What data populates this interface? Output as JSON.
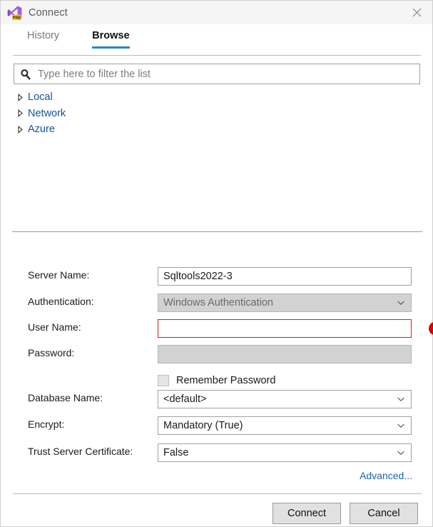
{
  "window": {
    "title": "Connect",
    "app_icon": "visual-studio-preview-icon",
    "close_icon": "close-icon"
  },
  "tabs": [
    {
      "label": "History",
      "active": false
    },
    {
      "label": "Browse",
      "active": true
    }
  ],
  "filter": {
    "icon": "search-icon",
    "placeholder": "Type here to filter the list",
    "value": ""
  },
  "tree": {
    "items": [
      {
        "label": "Local",
        "expanded": false,
        "icon": "chevron-right-icon"
      },
      {
        "label": "Network",
        "expanded": false,
        "icon": "chevron-right-icon"
      },
      {
        "label": "Azure",
        "expanded": false,
        "icon": "chevron-right-icon"
      }
    ]
  },
  "form": {
    "server_name": {
      "label": "Server Name:",
      "value": "Sqltools2022-3"
    },
    "authentication": {
      "label": "Authentication:",
      "value": "Windows Authentication"
    },
    "user_name": {
      "label": "User Name:",
      "value": "",
      "error_icon": "error-exclamation-icon"
    },
    "password": {
      "label": "Password:",
      "value": ""
    },
    "remember_password": {
      "label": "Remember Password",
      "checked": false
    },
    "database_name": {
      "label": "Database Name:",
      "value": "<default>"
    },
    "encrypt": {
      "label": "Encrypt:",
      "value": "Mandatory (True)"
    },
    "trust_server_certificate": {
      "label": "Trust Server Certificate:",
      "value": "False"
    },
    "advanced_link": "Advanced..."
  },
  "footer": {
    "connect_label": "Connect",
    "cancel_label": "Cancel"
  },
  "colors": {
    "accent": "#1c8ad1",
    "link": "#15539e",
    "error": "#e01b1b",
    "titlebar": "#f5f5f5"
  }
}
